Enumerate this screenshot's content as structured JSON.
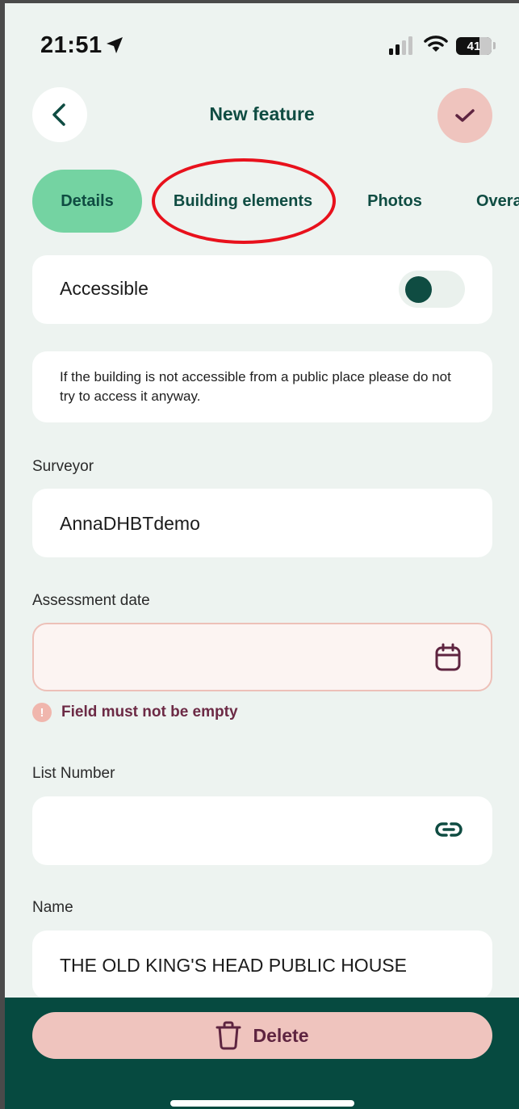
{
  "status_bar": {
    "time": "21:51",
    "battery": "41",
    "icons": [
      "location-arrow-icon",
      "signal-icon",
      "wifi-icon",
      "battery-icon"
    ]
  },
  "header": {
    "title": "New feature",
    "back_icon": "chevron-left-icon",
    "confirm_icon": "check-icon"
  },
  "tabs": [
    {
      "label": "Details",
      "active": true
    },
    {
      "label": "Building elements",
      "active": false,
      "highlighted": true
    },
    {
      "label": "Photos",
      "active": false
    },
    {
      "label": "Overall",
      "active": false
    }
  ],
  "highlight": {
    "color": "#e8111c"
  },
  "form": {
    "accessible": {
      "label": "Accessible",
      "value": false
    },
    "info": "If the building is not accessible from a public place please do not try to access it anyway.",
    "surveyor": {
      "label": "Surveyor",
      "value": "AnnaDHBTdemo"
    },
    "assessment_date": {
      "label": "Assessment date",
      "value": "",
      "error": "Field must not be empty",
      "icon": "calendar-icon"
    },
    "list_number": {
      "label": "List Number",
      "value": "",
      "icon": "link-icon"
    },
    "name": {
      "label": "Name",
      "value": "THE OLD KING'S HEAD PUBLIC HOUSE"
    }
  },
  "footer": {
    "delete_label": "Delete",
    "delete_icon": "trash-icon"
  },
  "colors": {
    "primary": "#0f4c42",
    "tab_active": "#74d3a2",
    "accent_pink": "#efc4be",
    "error_text": "#6c2a45",
    "background": "#edf3f0"
  }
}
